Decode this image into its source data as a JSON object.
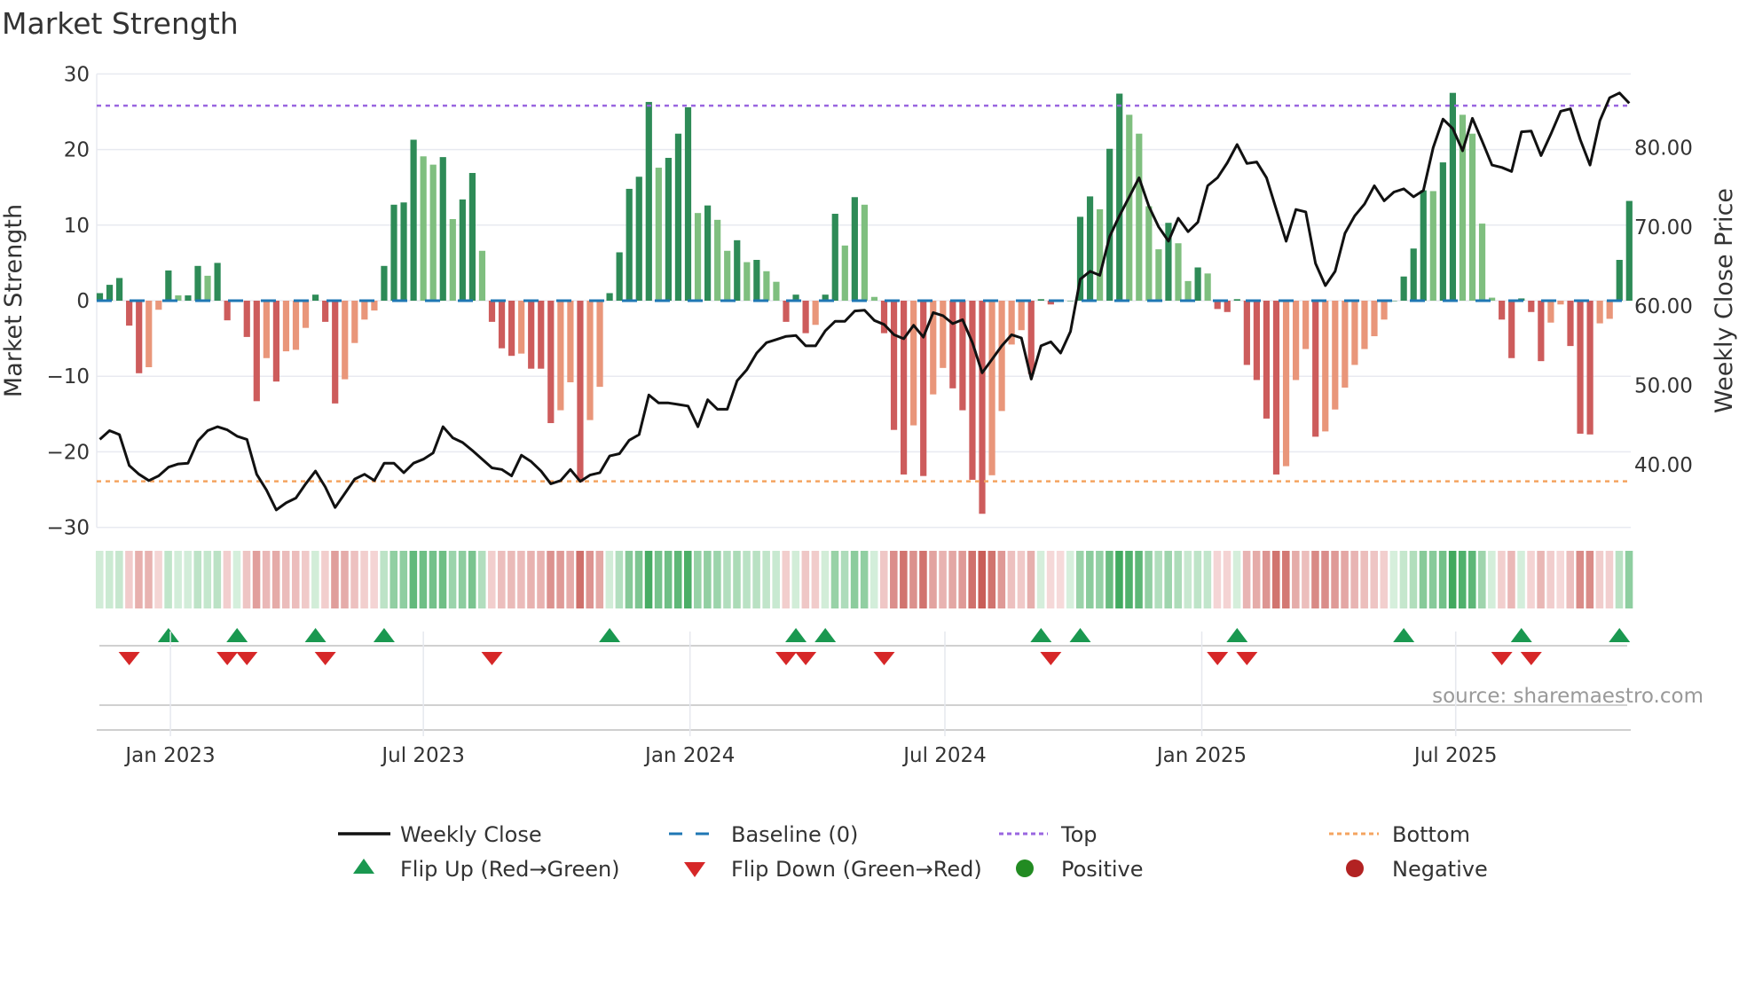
{
  "chart_data": {
    "type": "bar",
    "title": "Market Strength",
    "ylabel": "Market Strength",
    "y2label": "Weekly Close Price",
    "ylim": [
      -30,
      30
    ],
    "y2lim": [
      32.1,
      89.3
    ],
    "yticks": [
      "30",
      "20",
      "10",
      "0",
      "−10",
      "−20",
      "−30"
    ],
    "ytick_values": [
      30,
      20,
      10,
      0,
      -10,
      -20,
      -30
    ],
    "y2ticks": [
      "80.00",
      "70.00",
      "60.00",
      "50.00",
      "40.00"
    ],
    "y2tick_values": [
      80,
      70,
      60,
      50,
      40
    ],
    "xticks": [
      {
        "label": "Jan 2023",
        "week": 8.2
      },
      {
        "label": "Jul 2023",
        "week": 34.0
      },
      {
        "label": "Jan 2024",
        "week": 61.2
      },
      {
        "label": "Jul 2024",
        "week": 87.2
      },
      {
        "label": "Jan 2025",
        "week": 113.4
      },
      {
        "label": "Jul 2025",
        "week": 139.3
      }
    ],
    "top_level": 25.8,
    "bottom_level": -23.9,
    "baseline": 0,
    "strength": [
      1,
      2.1,
      3,
      -3.3,
      -9.6,
      -8.8,
      -1.2,
      4,
      0.7,
      0.7,
      4.6,
      3.3,
      5,
      -2.6,
      0.1,
      -4.8,
      -13.3,
      -7.6,
      -10.7,
      -6.7,
      -6.5,
      -3.6,
      0.8,
      -2.8,
      -13.6,
      -10.4,
      -5.6,
      -2.5,
      -1.3,
      4.6,
      12.7,
      13,
      21.3,
      19.1,
      18,
      19,
      10.8,
      13.4,
      16.9,
      6.6,
      -2.8,
      -6.3,
      -7.3,
      -7,
      -9,
      -9,
      -16.2,
      -14.5,
      -10.8,
      -24,
      -15.8,
      -11.4,
      1,
      6.4,
      14.8,
      16.4,
      26.3,
      17.6,
      18.9,
      22.1,
      25.6,
      11.6,
      12.6,
      10.7,
      6.6,
      8,
      5.1,
      5.4,
      3.9,
      2.5,
      -2.8,
      0.8,
      -4.3,
      -3.2,
      0.8,
      11.5,
      7.3,
      13.7,
      12.7,
      0.5,
      -4.3,
      -17.1,
      -23,
      -16.5,
      -23.2,
      -12.4,
      -8.9,
      -11.6,
      -14.5,
      -23.7,
      -28.2,
      -23.1,
      -14.6,
      -5.8,
      -3.9,
      -9.7,
      0.2,
      -0.5,
      -0.1,
      0,
      11.1,
      13.8,
      12.1,
      20.1,
      27.4,
      24.6,
      22.1,
      12.5,
      6.8,
      10.3,
      7.6,
      2.6,
      4.4,
      3.6,
      -1.1,
      -1.5,
      0.2,
      -8.5,
      -10.5,
      -15.6,
      -23,
      -21.9,
      -10.5,
      -6.4,
      -18,
      -17.3,
      -14.4,
      -11.5,
      -8.5,
      -6.4,
      -4.7,
      -2.5,
      0,
      3.2,
      6.9,
      14.6,
      14.5,
      18.3,
      27.5,
      24.6,
      22.1,
      10.2,
      0.4,
      -2.5,
      -7.6,
      0.3,
      -1.5,
      -8,
      -2.9,
      -0.5,
      -6,
      -17.6,
      -17.7,
      -3,
      -2.4,
      5.4,
      13.2
    ],
    "weekly_close": [
      43.2,
      44.3,
      43.8,
      39.9,
      38.8,
      38.0,
      38.6,
      39.7,
      40.1,
      40.2,
      43.0,
      44.3,
      44.8,
      44.4,
      43.6,
      43.2,
      38.8,
      36.8,
      34.3,
      35.2,
      35.8,
      37.6,
      39.2,
      37.2,
      34.6,
      36.4,
      38.2,
      38.8,
      38.0,
      40.2,
      40.2,
      39.0,
      40.2,
      40.7,
      41.5,
      44.8,
      43.4,
      42.8,
      41.8,
      40.7,
      39.6,
      39.4,
      38.6,
      41.2,
      40.4,
      39.2,
      37.6,
      38.0,
      39.4,
      37.9,
      38.7,
      39.0,
      41.1,
      41.4,
      43.1,
      43.8,
      48.8,
      47.8,
      47.8,
      47.6,
      47.4,
      44.8,
      48.2,
      47.0,
      47.0,
      50.6,
      52.0,
      54.1,
      55.4,
      55.8,
      56.2,
      56.3,
      55.0,
      55.0,
      56.9,
      58.1,
      58.1,
      59.4,
      59.5,
      58.2,
      57.7,
      56.4,
      55.9,
      57.6,
      56.1,
      59.2,
      58.8,
      57.8,
      58.3,
      55.4,
      51.6,
      53.3,
      55.0,
      56.4,
      56.0,
      50.8,
      55.0,
      55.5,
      54.1,
      56.8,
      63.4,
      64.4,
      63.9,
      68.8,
      71.4,
      73.8,
      76.2,
      72.6,
      70.0,
      68.2,
      71.1,
      69.4,
      70.6,
      75.2,
      76.2,
      78.1,
      80.4,
      78.0,
      78.2,
      76.2,
      72.2,
      68.2,
      72.2,
      71.9,
      65.4,
      62.6,
      64.4,
      69.2,
      71.4,
      72.9,
      75.2,
      73.3,
      74.4,
      74.8,
      73.8,
      74.6,
      80.0,
      83.6,
      82.4,
      79.6,
      83.7,
      80.8,
      77.8,
      77.5,
      77.0,
      82.0,
      82.1,
      79.0,
      81.7,
      84.6,
      84.9,
      81.0,
      77.8,
      83.4,
      86.3,
      86.9,
      85.6
    ],
    "flip_up_weeks": [
      8,
      15,
      23,
      30,
      53,
      72,
      75,
      97,
      101,
      117,
      134,
      146,
      156
    ],
    "flip_down_weeks": [
      4,
      14,
      16,
      24,
      41,
      71,
      73,
      81,
      98,
      115,
      118,
      144,
      147
    ],
    "legend": [
      {
        "label": "Weekly Close",
        "symbol": "line"
      },
      {
        "label": "Baseline (0)",
        "symbol": "dash"
      },
      {
        "label": "Top",
        "symbol": "dot"
      },
      {
        "label": "Bottom",
        "symbol": "dot"
      },
      {
        "label": "Flip Up (Red→Green)",
        "symbol": "triangle-up"
      },
      {
        "label": "Flip Down (Green→Red)",
        "symbol": "triangle-down"
      },
      {
        "label": "Positive",
        "symbol": "circle"
      },
      {
        "label": "Negative",
        "symbol": "circle"
      }
    ],
    "legend_position": "bottom",
    "source": "source: sharemaestro.com"
  },
  "colors": {
    "pos_strong": "#2e8b57",
    "pos_weak": "#7fbf7f",
    "neg_strong": "#cd5c5c",
    "neg_weak": "#e9967a",
    "close": "#111111",
    "baseline": "#1f77b4",
    "top": "#9a66e0",
    "bottom": "#f4a460",
    "flip_up": "#1a9850",
    "flip_down": "#d62728",
    "positive": "#228b22",
    "negative": "#b22222"
  }
}
